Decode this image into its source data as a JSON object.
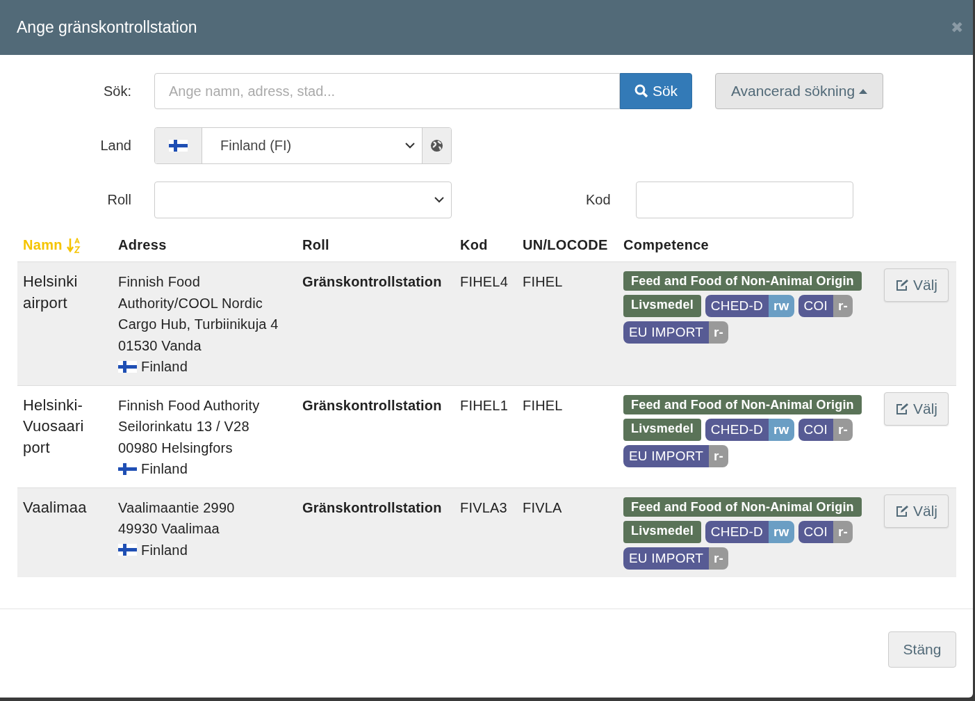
{
  "dialog": {
    "title": "Ange gränskontrollstation",
    "close": "✖"
  },
  "search": {
    "label": "Sök:",
    "placeholder": "Ange namn, adress, stad...",
    "button": "Sök",
    "advanced": "Avancerad sökning"
  },
  "filters": {
    "land_label": "Land",
    "land_value": "Finland (FI)",
    "roll_label": "Roll",
    "kod_label": "Kod"
  },
  "table": {
    "columns": [
      {
        "label": "Namn",
        "sorted": true
      },
      {
        "label": "Adress",
        "sorted": false
      },
      {
        "label": "Roll",
        "sorted": false
      },
      {
        "label": "Kod",
        "sorted": false
      },
      {
        "label": "UN/LOCODE",
        "sorted": false
      },
      {
        "label": "Competence",
        "sorted": false
      }
    ],
    "rows": [
      {
        "name": "Helsinki airport",
        "address": [
          "Finnish Food",
          "Authority/COOL Nordic",
          "Cargo Hub, Turbiinikuja 4",
          "01530 Vanda"
        ],
        "country": "Finland",
        "role": "Gränskontrollstation",
        "code": "FIHEL4",
        "locode": "FIHEL",
        "competences": [
          {
            "kind": "category",
            "label": "Feed and Food of Non-Animal Origin"
          },
          {
            "kind": "category",
            "label": "Livsmedel"
          },
          {
            "kind": "permission",
            "label": "CHED-D",
            "access": "rw",
            "color": "#6a9ec4"
          },
          {
            "kind": "permission",
            "label": "COI",
            "access": "r-",
            "color": "#999999"
          },
          {
            "kind": "permission",
            "label": "EU IMPORT",
            "access": "r-",
            "color": "#999999"
          }
        ],
        "action": "Välj"
      },
      {
        "name": "Helsinki-Vuosaari port",
        "address": [
          "Finnish Food Authority",
          "Seilorinkatu 13 / V28",
          "00980 Helsingfors"
        ],
        "country": "Finland",
        "role": "Gränskontrollstation",
        "code": "FIHEL1",
        "locode": "FIHEL",
        "competences": [
          {
            "kind": "category",
            "label": "Feed and Food of Non-Animal Origin"
          },
          {
            "kind": "category",
            "label": "Livsmedel"
          },
          {
            "kind": "permission",
            "label": "CHED-D",
            "access": "rw",
            "color": "#6a9ec4"
          },
          {
            "kind": "permission",
            "label": "COI",
            "access": "r-",
            "color": "#999999"
          },
          {
            "kind": "permission",
            "label": "EU IMPORT",
            "access": "r-",
            "color": "#999999"
          }
        ],
        "action": "Välj"
      },
      {
        "name": "Vaalimaa",
        "address": [
          "Vaalimaantie 2990",
          "49930 Vaalimaa"
        ],
        "country": "Finland",
        "role": "Gränskontrollstation",
        "code": "FIVLA3",
        "locode": "FIVLA",
        "competences": [
          {
            "kind": "category",
            "label": "Feed and Food of Non-Animal Origin"
          },
          {
            "kind": "category",
            "label": "Livsmedel"
          },
          {
            "kind": "permission",
            "label": "CHED-D",
            "access": "rw",
            "color": "#6a9ec4"
          },
          {
            "kind": "permission",
            "label": "COI",
            "access": "r-",
            "color": "#999999"
          },
          {
            "kind": "permission",
            "label": "EU IMPORT",
            "access": "r-",
            "color": "#999999"
          }
        ],
        "action": "Välj"
      }
    ]
  },
  "footer": {
    "close_button": "Stäng"
  }
}
